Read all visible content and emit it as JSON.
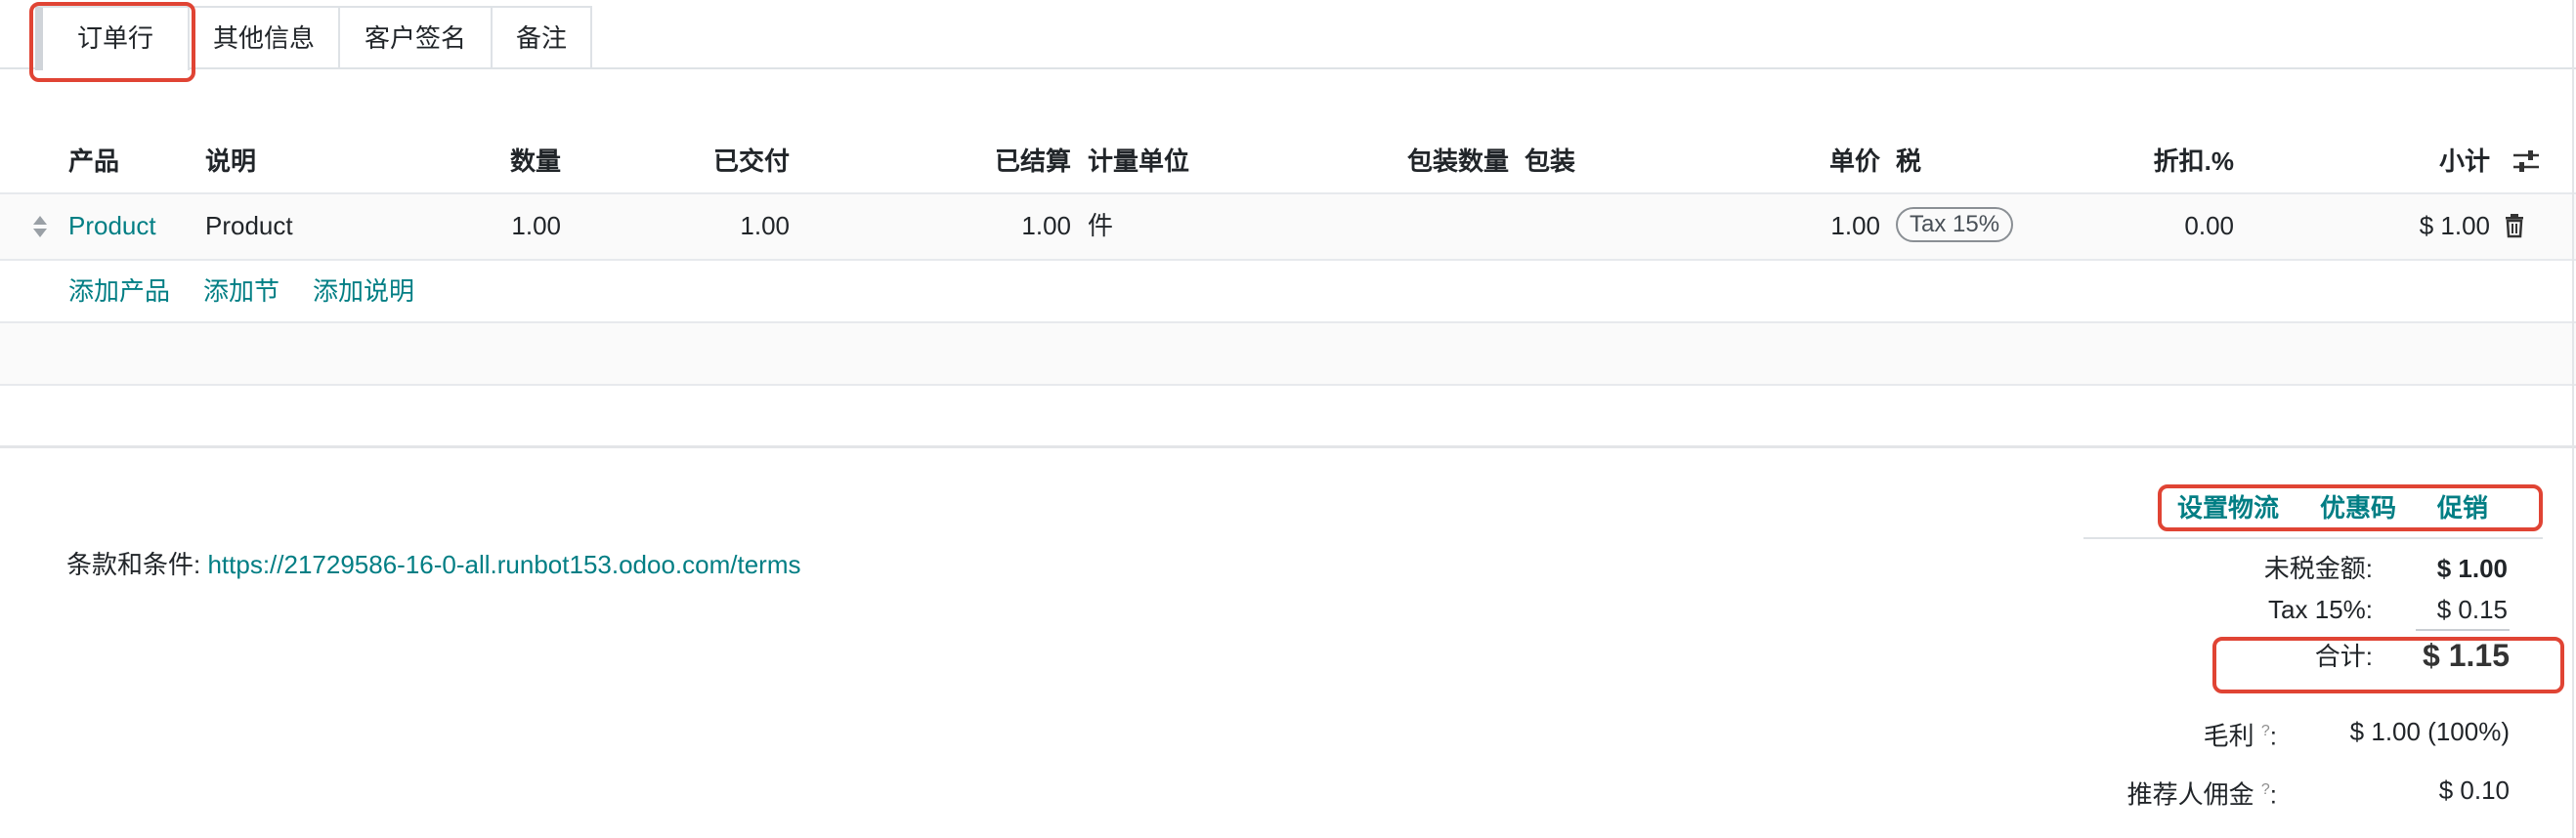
{
  "tabs": [
    "订单行",
    "其他信息",
    "客户签名",
    "备注"
  ],
  "table": {
    "headers": {
      "product": "产品",
      "description": "说明",
      "quantity": "数量",
      "delivered": "已交付",
      "invoiced": "已结算",
      "uom": "计量单位",
      "packaging_qty": "包装数量",
      "packaging": "包装",
      "unit_price": "单价",
      "taxes": "税",
      "discount": "折扣.%",
      "subtotal": "小计"
    },
    "row": {
      "product": "Product",
      "description": "Product",
      "quantity": "1.00",
      "delivered": "1.00",
      "invoiced": "1.00",
      "uom": "件",
      "unit_price": "1.00",
      "tax": "Tax 15%",
      "discount": "0.00",
      "subtotal": "$ 1.00"
    },
    "actions": {
      "add_product": "添加产品",
      "add_section": "添加节",
      "add_note": "添加说明"
    }
  },
  "terms": {
    "label": "条款和条件: ",
    "url": "https://21729586-16-0-all.runbot153.odoo.com/terms"
  },
  "buttons": {
    "shipping": "设置物流",
    "coupon": "优惠码",
    "promotions": "促销"
  },
  "totals": {
    "untaxed_label": "未税金额:",
    "untaxed_value": "$ 1.00",
    "tax_label": "Tax 15%:",
    "tax_value": "$ 0.15",
    "total_label": "合计:",
    "total_value": "$ 1.15",
    "margin_label": "毛利",
    "margin_value": "$ 1.00 (100%)",
    "commission_label": "推荐人佣金",
    "commission_value": "$ 0.10",
    "help_mark": "?",
    "colon": ":"
  }
}
